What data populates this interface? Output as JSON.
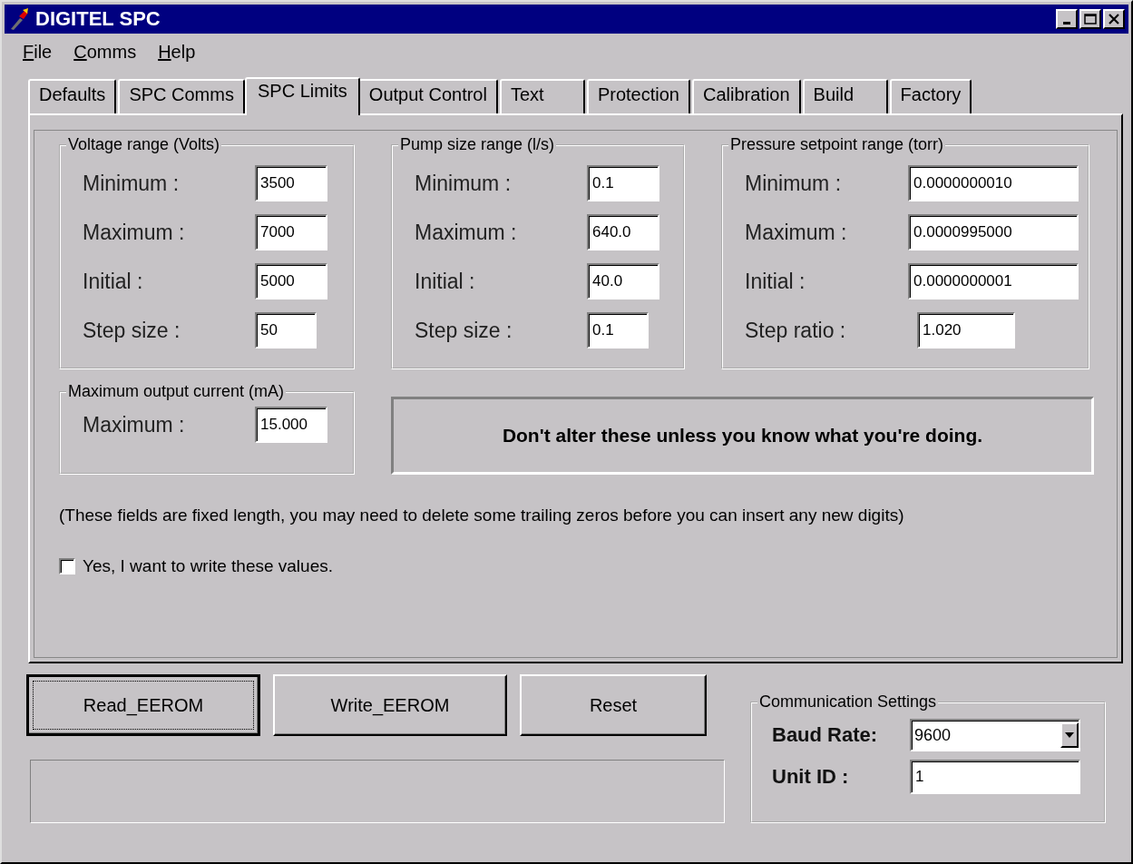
{
  "window": {
    "title": "DIGITEL SPC"
  },
  "menu": [
    "File",
    "Comms",
    "Help"
  ],
  "tabs": [
    {
      "label": "Defaults",
      "selected": false
    },
    {
      "label": "SPC Comms",
      "selected": false
    },
    {
      "label": "SPC Limits",
      "selected": true
    },
    {
      "label": "Output Control",
      "selected": false
    },
    {
      "label": "Text",
      "selected": false
    },
    {
      "label": "Protection",
      "selected": false
    },
    {
      "label": "Calibration",
      "selected": false
    },
    {
      "label": "Build",
      "selected": false
    },
    {
      "label": "Factory",
      "selected": false
    }
  ],
  "groups": [
    {
      "title": "Voltage range (Volts)",
      "fields": [
        {
          "label": "Minimum :",
          "value": "3500"
        },
        {
          "label": "Maximum :",
          "value": "7000"
        },
        {
          "label": "Initial :",
          "value": "5000"
        },
        {
          "label": "Step size :",
          "value": "50"
        }
      ]
    },
    {
      "title": "Pump size range (l/s)",
      "fields": [
        {
          "label": "Minimum :",
          "value": "0.1"
        },
        {
          "label": "Maximum :",
          "value": "640.0"
        },
        {
          "label": "Initial :",
          "value": "40.0"
        },
        {
          "label": "Step size :",
          "value": "0.1"
        }
      ]
    },
    {
      "title": "Pressure setpoint range (torr)",
      "fields": [
        {
          "label": "Minimum :",
          "value": "0.0000000010"
        },
        {
          "label": "Maximum :",
          "value": "0.0000995000"
        },
        {
          "label": "Initial :",
          "value": "0.0000000001"
        },
        {
          "label": "Step ratio :",
          "value": "1.020"
        }
      ]
    }
  ],
  "max_current": {
    "title": "Maximum output current (mA)",
    "fields": [
      {
        "label": "Maximum :",
        "value": "15.000"
      }
    ]
  },
  "warning": "Don't alter these unless you know what you're doing.",
  "note": "(These fields are fixed length, you may need to delete some trailing zeros before you can insert any new digits)",
  "confirm": {
    "label": "Yes, I want to write these values.",
    "checked": false
  },
  "buttons": [
    {
      "label": "Read_EEROM",
      "focused": true
    },
    {
      "label": "Write_EEROM",
      "focused": false
    },
    {
      "label": "Reset",
      "focused": false
    }
  ],
  "comm": {
    "title": "Communication Settings",
    "baud_rate": {
      "label": "Baud Rate:",
      "value": "9600"
    },
    "unit_id": {
      "label": "Unit ID :",
      "value": "1"
    }
  }
}
